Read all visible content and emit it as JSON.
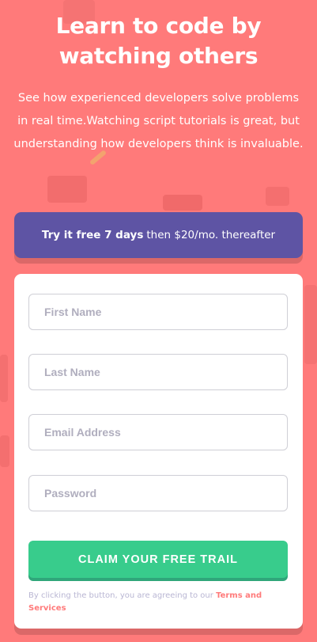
{
  "header": {
    "title": "Learn to code by watching others",
    "description": "See how experienced developers solve problems in real time.Watching script tutorials is great, but understanding how developers think is invaluable."
  },
  "promo": {
    "bold": "Try it free 7 days",
    "rest": "then $20/mo. thereafter"
  },
  "form": {
    "first_name_placeholder": "First Name",
    "last_name_placeholder": "Last Name",
    "email_placeholder": "Email Address",
    "password_placeholder": "Password",
    "submit_label": "CLAIM YOUR FREE TRAIL",
    "terms_prefix": "By clicking the button, you are agreeing to our",
    "terms_link": "Terms and Services"
  },
  "colors": {
    "background": "#ff7a7a",
    "promo": "#5e54a4",
    "cta": "#38cc8c",
    "link": "#ff7a7a"
  }
}
